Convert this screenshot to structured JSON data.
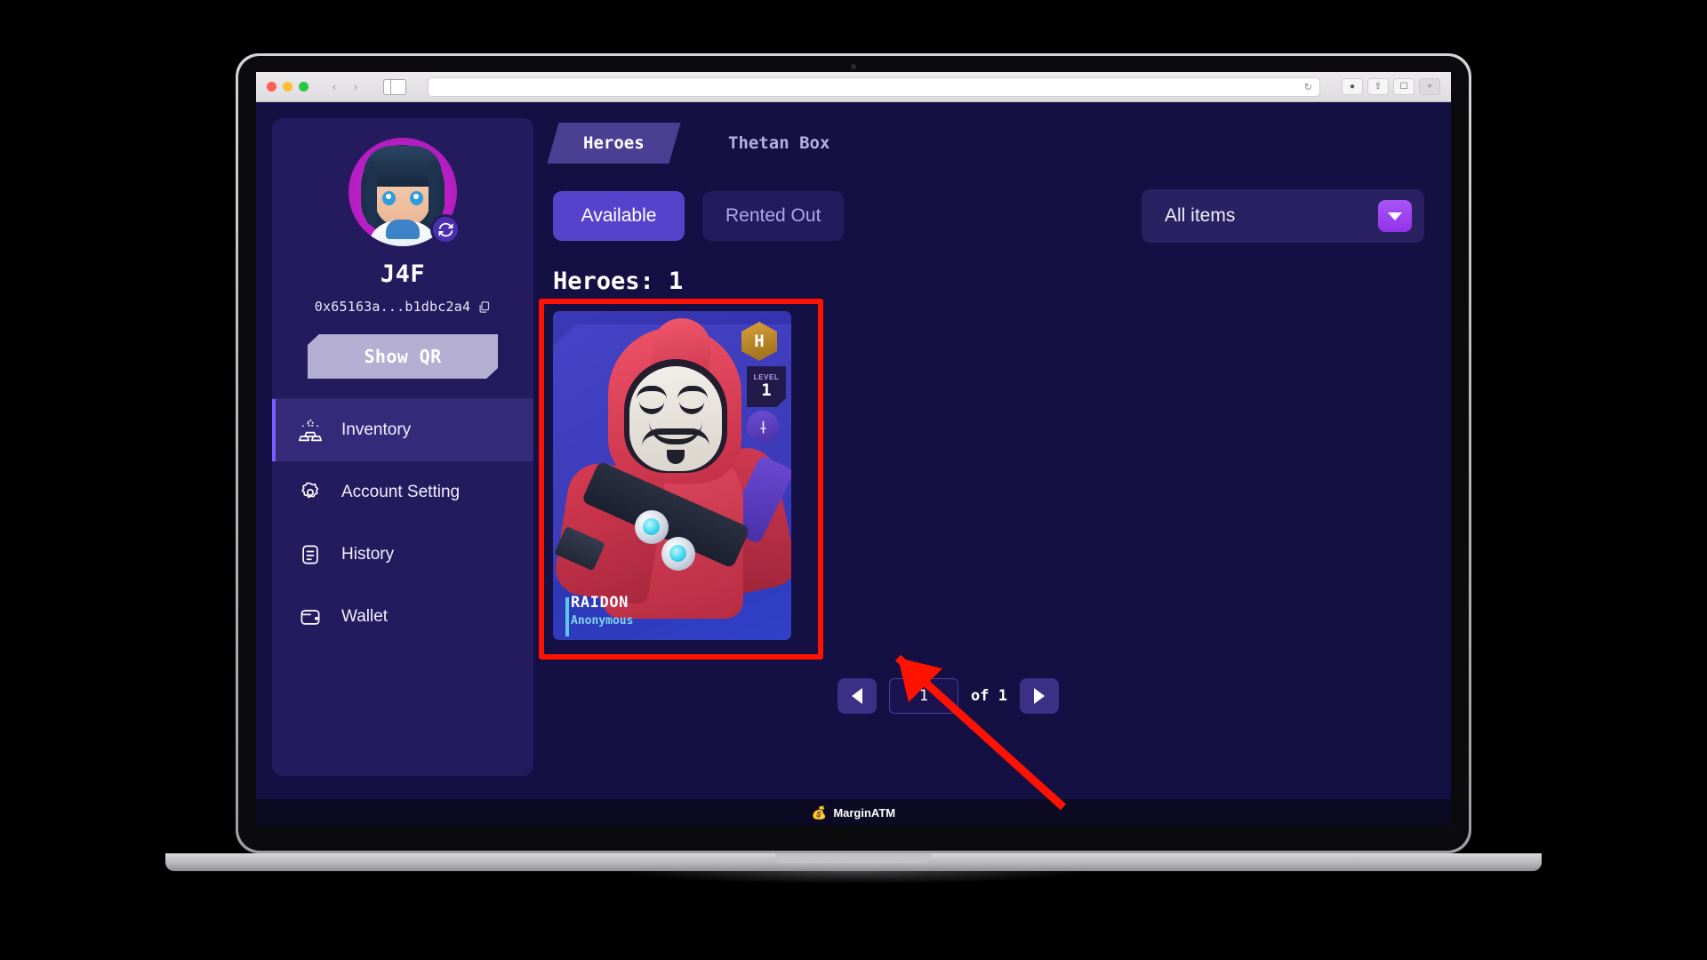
{
  "browser": {
    "traffic_lights": [
      "close",
      "minimize",
      "zoom"
    ],
    "back_label": "‹",
    "forward_label": "›",
    "url_value": "",
    "reload_label": "↻",
    "right_buttons": [
      "download-icon",
      "share-icon",
      "tabs-icon",
      "new-tab-icon"
    ]
  },
  "sidebar": {
    "username": "J4F",
    "wallet_address": "0x65163a...b1dbc2a4",
    "copy_icon": "copy-icon",
    "refresh_icon": "refresh-avatar-icon",
    "show_qr_label": "Show QR",
    "items": [
      {
        "label": "Inventory",
        "icon": "inventory-icon",
        "active": true
      },
      {
        "label": "Account Setting",
        "icon": "gear-icon",
        "active": false
      },
      {
        "label": "History",
        "icon": "document-icon",
        "active": false
      },
      {
        "label": "Wallet",
        "icon": "wallet-icon",
        "active": false
      }
    ]
  },
  "main": {
    "tabs": [
      {
        "label": "Heroes",
        "active": true
      },
      {
        "label": "Thetan Box",
        "active": false
      }
    ],
    "filters": [
      {
        "label": "Available",
        "active": true
      },
      {
        "label": "Rented Out",
        "active": false
      }
    ],
    "dropdown": {
      "selected": "All items",
      "caret_icon": "chevron-down-icon"
    },
    "heroes_count_label": "Heroes: 1",
    "cards": [
      {
        "name": "RAIDON",
        "subtitle": "Anonymous",
        "rarity_badge": "H",
        "level_label": "LEVEL",
        "level_value": "1",
        "class_icon": "dagger-icon",
        "highlighted": true
      }
    ],
    "pagination": {
      "prev_icon": "chevron-left-icon",
      "page_value": "1",
      "of_label": "of 1",
      "next_icon": "chevron-right-icon"
    }
  },
  "bottom_bar": {
    "logo_icon": "margin-atm-logo",
    "text": "MarginATM"
  },
  "colors": {
    "app_bg": "#151043",
    "sidebar_bg": "#241b5e",
    "accent_purple": "#5743cb",
    "active_menu_bg": "#352a7a",
    "menu_accent_bar": "#7b5cff",
    "dropdown_btn": "#a855f7",
    "highlight_red": "#ff1200",
    "hero_sub_cyan": "#7fd3ef",
    "rarity_gold": "#d9a23a"
  }
}
